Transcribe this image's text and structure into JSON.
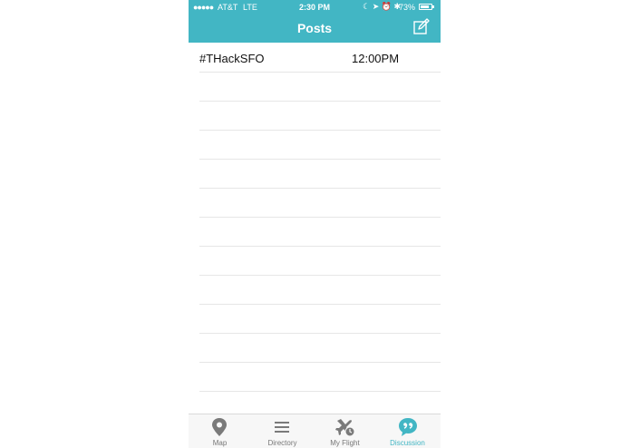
{
  "status_bar": {
    "signal": "●●●●●",
    "carrier": "AT&T",
    "network": "LTE",
    "time": "2:30 PM",
    "icons": "☾ ➤ ⏰ ✱",
    "battery": "73%"
  },
  "nav": {
    "title": "Posts",
    "compose_icon": "compose-icon",
    "accent_color": "#42b6c4"
  },
  "posts": [
    {
      "title": "#THackSFO",
      "time": "12:00PM"
    }
  ],
  "tabs": [
    {
      "label": "Map",
      "icon": "map-pin-icon"
    },
    {
      "label": "Directory",
      "icon": "list-icon"
    },
    {
      "label": "My Flight",
      "icon": "plane-clock-icon"
    },
    {
      "label": "Discussion",
      "icon": "quote-bubble-icon",
      "active": true
    }
  ]
}
